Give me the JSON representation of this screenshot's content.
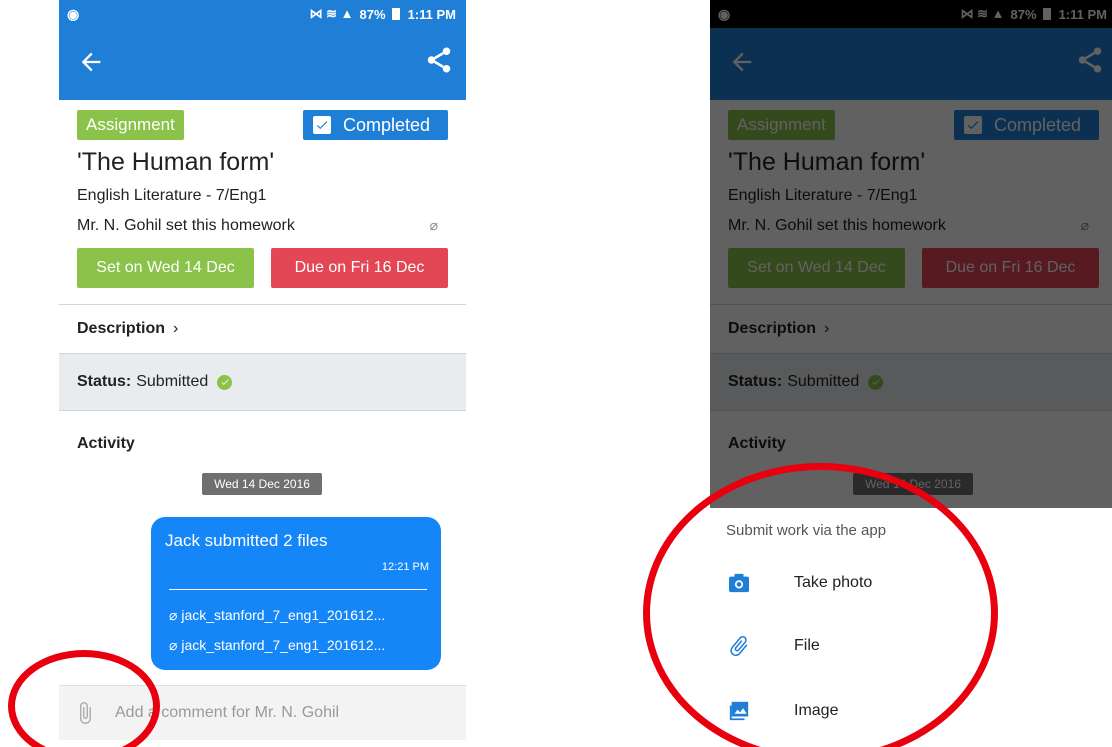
{
  "status_bar": {
    "left_icon": "sync-icon",
    "icons": "⋈ ≋ ▲",
    "battery": "87%",
    "time": "1:11 PM"
  },
  "assignment": {
    "tag": "Assignment",
    "completed_label": "Completed",
    "title": "'The Human form'",
    "subject": "English Literature - 7/Eng1",
    "teacher_line": "Mr. N. Gohil set this homework",
    "set_on": "Set on Wed 14 Dec",
    "due_on": "Due on Fri 16 Dec"
  },
  "description_label": "Description",
  "status": {
    "label": "Status:",
    "value": "Submitted"
  },
  "activity": {
    "title": "Activity",
    "date": "Wed 14 Dec 2016",
    "message": {
      "text": "Jack submitted 2 files",
      "time": "12:21 PM",
      "files": [
        "jack_stanford_7_eng1_201612...",
        "jack_stanford_7_eng1_201612..."
      ]
    }
  },
  "comment_placeholder": "Add a comment for Mr. N. Gohil",
  "sheet": {
    "title": "Submit work via the app",
    "items": [
      {
        "label": "Take photo",
        "icon": "camera-icon"
      },
      {
        "label": "File",
        "icon": "paperclip-icon"
      },
      {
        "label": "Image",
        "icon": "image-icon"
      }
    ]
  },
  "colors": {
    "primary": "#1f7fd6",
    "green": "#8bc34a",
    "red": "#e34654",
    "bubble": "#1486f8",
    "annotation": "#e8000f"
  }
}
